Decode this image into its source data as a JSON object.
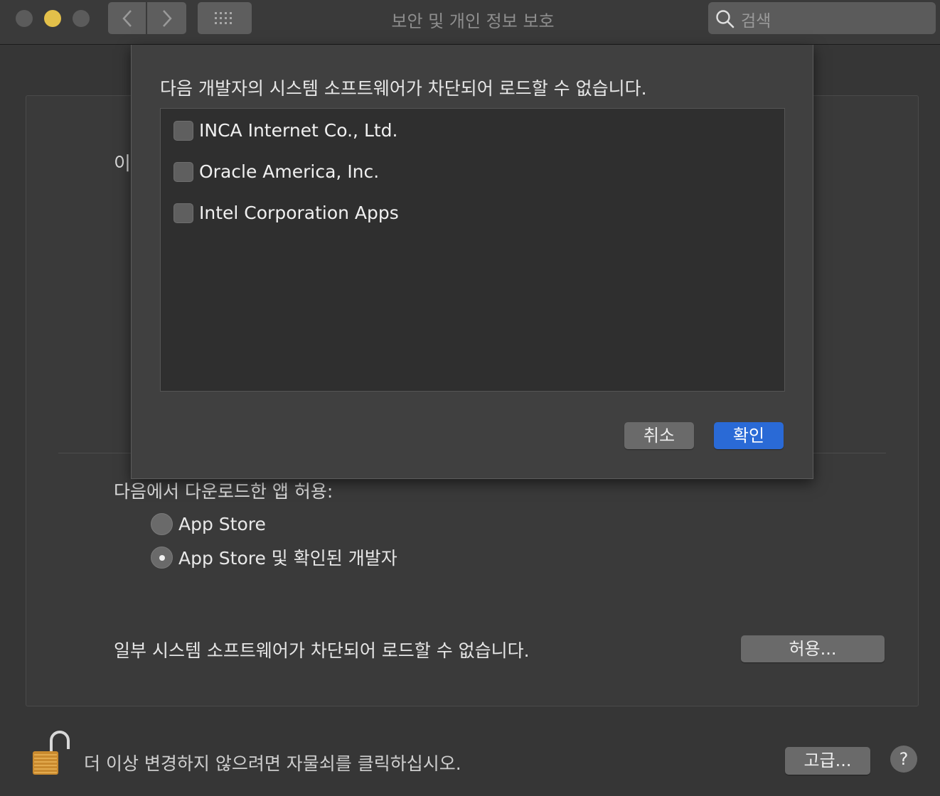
{
  "window": {
    "title": "보안 및 개인 정보 보호",
    "search_placeholder": "검색"
  },
  "panel": {
    "partial_label": "이",
    "allow_downloads_label": "다음에서 다운로드한 앱 허용:",
    "radio_options": [
      {
        "label": "App Store",
        "selected": false
      },
      {
        "label": "App Store 및 확인된 개발자",
        "selected": true
      }
    ],
    "blocked_software_text": "일부 시스템 소프트웨어가 차단되어 로드할 수 없습니다.",
    "allow_button": "허용..."
  },
  "bottom": {
    "lock_text": "더 이상 변경하지 않으려면 자물쇠를 클릭하십시오.",
    "advanced_button": "고급...",
    "help_button": "?"
  },
  "sheet": {
    "title": "다음 개발자의 시스템 소프트웨어가 차단되어 로드할 수 없습니다.",
    "developers": [
      {
        "label": "INCA Internet Co., Ltd.",
        "checked": false
      },
      {
        "label": "Oracle America, Inc.",
        "checked": false
      },
      {
        "label": "Intel Corporation Apps",
        "checked": false
      }
    ],
    "cancel_button": "취소",
    "ok_button": "확인"
  },
  "colors": {
    "accent_blue": "#2a6ad6",
    "minimize_yellow": "#e3c04a",
    "lock_gold": "#c98a2e"
  }
}
